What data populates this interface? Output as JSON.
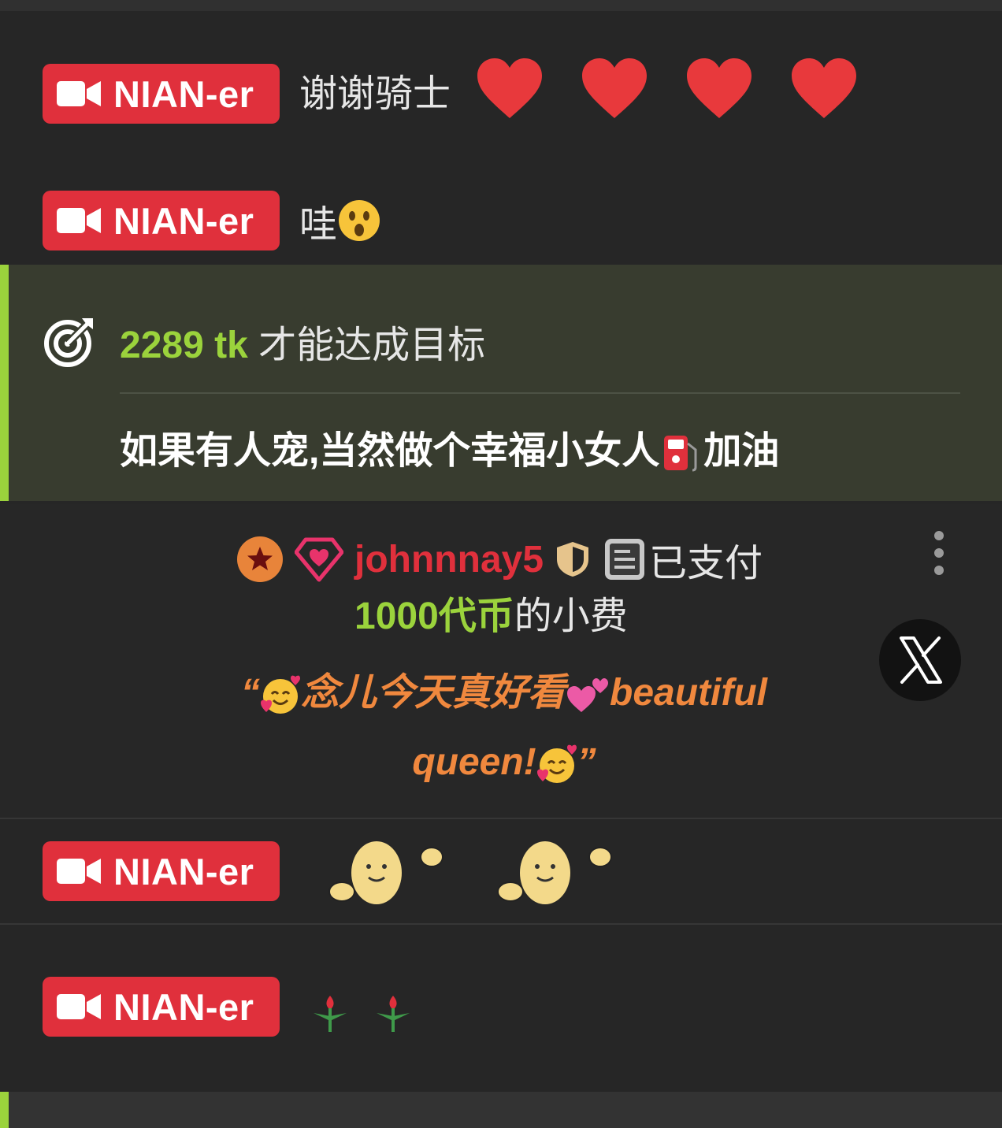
{
  "messages": [
    {
      "user": "NIAN-er",
      "text": "谢谢骑士"
    },
    {
      "user": "NIAN-er",
      "text": "哇"
    },
    {
      "user": "NIAN-er",
      "text": ""
    },
    {
      "user": "NIAN-er",
      "text": ""
    }
  ],
  "goal": {
    "amount": "2289 tk",
    "text": "才能达成目标",
    "subject": "如果有人宠,当然做个幸福小女人",
    "subject_suffix": "加油"
  },
  "tip": {
    "username": "johnnnay5",
    "paid_text": "已支付",
    "amount": "1000代币",
    "rest": "的小费",
    "quote_open": "“",
    "quote_part1": "念儿今天真好看",
    "quote_part2": "beautiful",
    "quote_part3": "queen!",
    "quote_close": "”"
  },
  "colors": {
    "badge": "#e0303c",
    "accent_green": "#9bd33c",
    "quote_orange": "#f0883e",
    "background": "#262626",
    "goal_background": "#383c2f"
  },
  "icons": [
    "video-camera-icon",
    "heart-icon",
    "surprised-face-emoji",
    "target-icon",
    "fuel-pump-emoji",
    "star-badge-icon",
    "diamond-heart-icon",
    "shield-icon",
    "document-icon",
    "more-options-icon",
    "x-logo-icon",
    "smiling-face-with-hearts-emoji",
    "two-hearts-emoji",
    "waving-egg-sticker",
    "rose-emoji"
  ]
}
